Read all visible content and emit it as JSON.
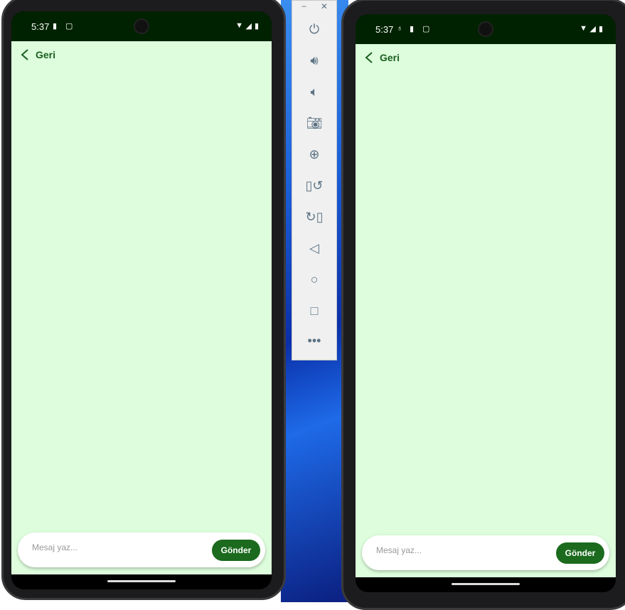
{
  "phones": [
    {
      "time": "5:37",
      "back_label": "Geri",
      "placeholder": "Mesaj yaz...",
      "send_label": "Gönder",
      "status_icons": [
        "sd-card-icon",
        "screen-icon"
      ]
    },
    {
      "time": "5:37",
      "back_label": "Geri",
      "placeholder": "Mesaj yaz...",
      "send_label": "Gönder",
      "status_icons": [
        "debug-icon",
        "sd-card-icon",
        "screen-icon"
      ]
    }
  ],
  "emulator_toolbar": {
    "buttons": [
      "power",
      "volume-up",
      "volume-down",
      "camera",
      "zoom",
      "rotate-left",
      "rotate-right",
      "back",
      "home",
      "overview",
      "more"
    ]
  },
  "colors": {
    "status_bar": "#002200",
    "background": "#ddfddc",
    "accent": "#1b6a1e"
  }
}
